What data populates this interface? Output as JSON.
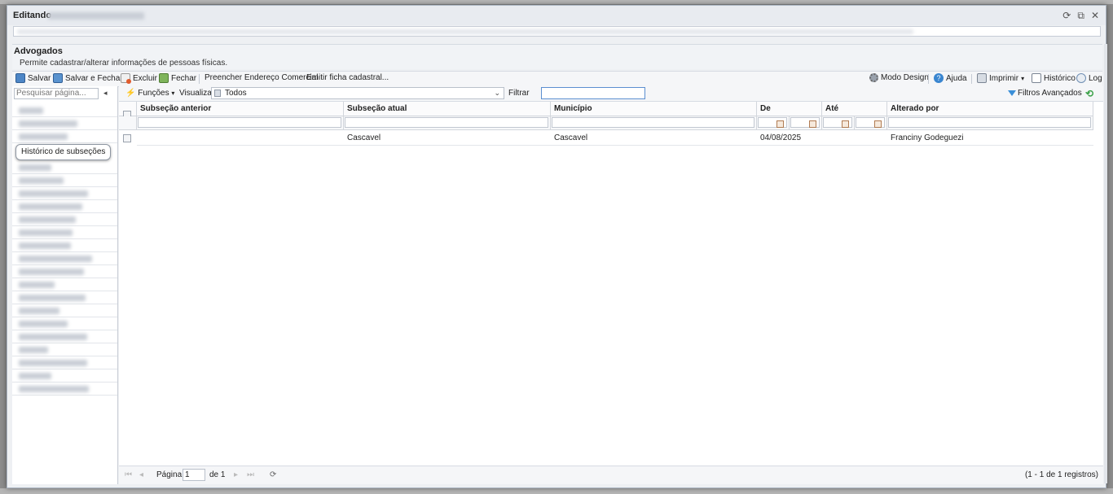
{
  "window": {
    "title": "Editando",
    "refresh_icon": "refresh-icon",
    "popout_icon": "popout-icon",
    "close_icon": "close-icon"
  },
  "header": {
    "title": "Advogados",
    "description": "Permite cadastrar/alterar informações de pessoas físicas."
  },
  "toolbar": {
    "save": "Salvar",
    "save_close": "Salvar e Fechar",
    "delete": "Excluir",
    "close": "Fechar",
    "fill_address": "Preencher Endereço Comercial",
    "emit_form": "Emitir ficha cadastral...",
    "design_mode": "Modo Design",
    "help": "Ajuda",
    "print": "Imprimir",
    "history": "Histórico",
    "log": "Log"
  },
  "sidebar": {
    "search_placeholder": "Pesquisar página...",
    "active_item": "Histórico de subseções"
  },
  "gridbar": {
    "functions": "Funções",
    "view_label": "Visualizar",
    "view_value": "Todos",
    "filter_label": "Filtrar",
    "advanced_filters": "Filtros Avançados"
  },
  "table": {
    "columns": [
      "Subseção anterior",
      "Subseção atual",
      "Município",
      "De",
      "Até",
      "Alterado por"
    ],
    "rows": [
      [
        "",
        "Cascavel",
        "Cascavel",
        "04/08/2025",
        "",
        "Franciny Godeguezi"
      ]
    ]
  },
  "pager": {
    "page_label": "Página",
    "page_value": "1",
    "of_label": "de 1",
    "records": "(1 - 1 de 1 registros)"
  },
  "colors": {
    "accent": "#3a86d0",
    "window_bg": "#eef0f3"
  }
}
